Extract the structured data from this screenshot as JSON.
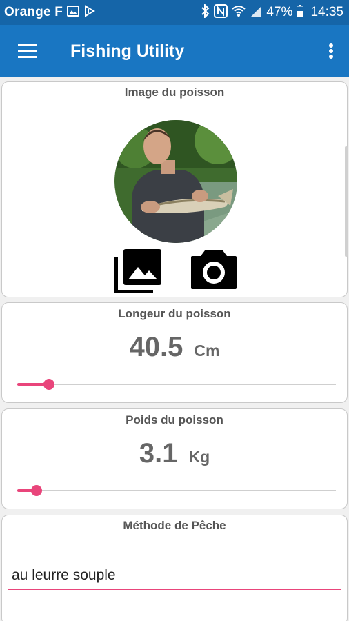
{
  "status_bar": {
    "carrier": "Orange F",
    "battery": "47%",
    "time": "14:35"
  },
  "app_bar": {
    "title": "Fishing Utility",
    "menu_icon": "hamburger-menu-icon",
    "overflow_icon": "more-vert-icon"
  },
  "image_card": {
    "title": "Image du poisson",
    "gallery_icon": "photo-library-icon",
    "camera_icon": "camera-icon"
  },
  "length_card": {
    "title": "Longeur du poisson",
    "value": "40.5",
    "unit": "Cm",
    "slider_fraction": 0.1
  },
  "weight_card": {
    "title": "Poids du poisson",
    "value": "3.1",
    "unit": "Kg",
    "slider_fraction": 0.06
  },
  "method_card": {
    "title": "Méthode de Pêche",
    "value": "au leurre souple"
  },
  "colors": {
    "status_bar": "#1565a8",
    "app_bar": "#1976c2",
    "accent": "#e9457b"
  }
}
